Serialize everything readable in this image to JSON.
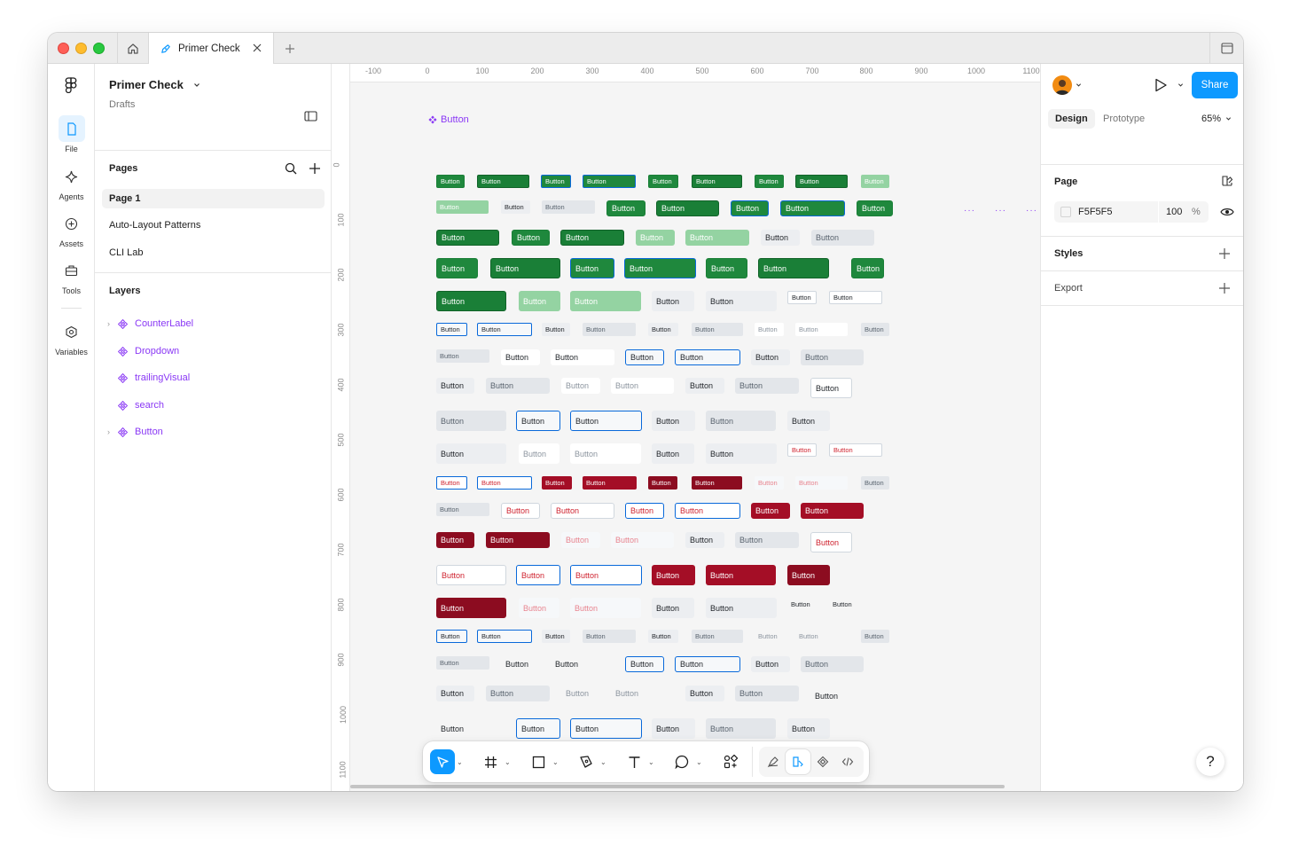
{
  "tabs": {
    "document_title": "Primer Check"
  },
  "rail": {
    "items": [
      {
        "label": "File",
        "icon": "file-icon"
      },
      {
        "label": "Agents",
        "icon": "sparkle-icon"
      },
      {
        "label": "Assets",
        "icon": "assets-icon"
      },
      {
        "label": "Tools",
        "icon": "toolbox-icon"
      },
      {
        "label": "Variables",
        "icon": "variables-icon"
      }
    ]
  },
  "left_panel": {
    "project_title": "Primer Check",
    "project_subtitle": "Drafts",
    "pages_heading": "Pages",
    "pages": [
      "Page 1",
      "Auto-Layout Patterns",
      "CLI Lab"
    ],
    "layers_heading": "Layers",
    "layers": [
      "CounterLabel",
      "Dropdown",
      "trailingVisual",
      "search",
      "Button"
    ]
  },
  "ruler": {
    "h_labels": [
      "-100",
      "0",
      "100",
      "200",
      "300",
      "400",
      "500",
      "600",
      "700",
      "800",
      "900",
      "1000",
      "1100"
    ],
    "v_labels": [
      "0",
      "100",
      "200",
      "300",
      "400",
      "500",
      "600",
      "700",
      "800",
      "900",
      "1000",
      "1100"
    ]
  },
  "canvas": {
    "frame_label": "Button",
    "button_label": "Button",
    "background": "#F5F5F5"
  },
  "right_panel": {
    "share_label": "Share",
    "tab_design": "Design",
    "tab_prototype": "Prototype",
    "zoom": "65%",
    "page_heading": "Page",
    "page_color": "F5F5F5",
    "page_opacity": "100",
    "opacity_unit": "%",
    "styles_heading": "Styles",
    "export_heading": "Export"
  },
  "help_label": "?",
  "colors": {
    "accent": "#0d99ff",
    "component": "#8a38f5",
    "primer_green": "#1f883d",
    "primer_red": "#a40e26"
  }
}
